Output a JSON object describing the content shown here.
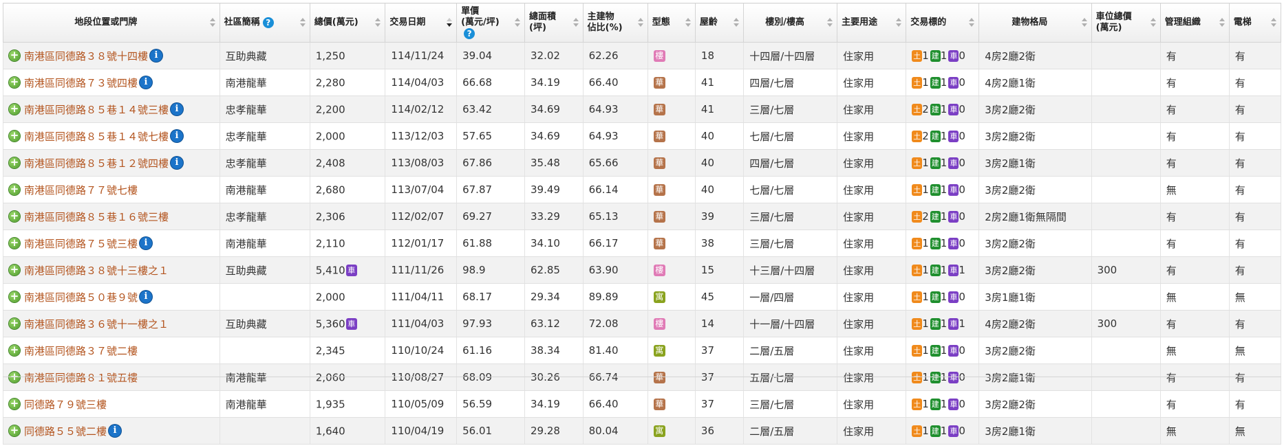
{
  "headers": [
    {
      "label": "地段位置或門牌",
      "center": true
    },
    {
      "label": "社區簡稱",
      "help": "?"
    },
    {
      "label": "總價(萬元)"
    },
    {
      "label": "交易日期",
      "active": true
    },
    {
      "label": "單價\n(萬元/坪)",
      "help": "?"
    },
    {
      "label": "總面積\n(坪)"
    },
    {
      "label": "主建物\n佔比(%)"
    },
    {
      "label": "型態"
    },
    {
      "label": "屋齡"
    },
    {
      "label": "樓別/樓高",
      "center": true
    },
    {
      "label": "主要用途"
    },
    {
      "label": "交易標的"
    },
    {
      "label": "建物格局",
      "center": true
    },
    {
      "label": "車位總價\n(萬元)"
    },
    {
      "label": "管理組織"
    },
    {
      "label": "電梯"
    }
  ],
  "labels": {
    "land": "土",
    "building": "建",
    "car": "車",
    "expand": "+",
    "info": "i"
  },
  "colors": {
    "land": "#f08a1c",
    "building": "#1f8f2e",
    "car": "#7b3fc4",
    "type_樓": "#e07bb6",
    "type_華": "#b5734a",
    "type_寓": "#8aa31f"
  },
  "rows": [
    {
      "address": "南港區同德路３８號十四樓",
      "info": true,
      "community": "互助典藏",
      "total": "1,250",
      "car_in_total": false,
      "date": "114/11/24",
      "unit": "39.04",
      "area": "32.02",
      "ratio": "62.26",
      "type": "樓",
      "age": "18",
      "floor": "十四層/十四層",
      "use": "住家用",
      "land_n": "1",
      "bldg_n": "1",
      "car_n": "0",
      "layout": "4房2廳2衛",
      "car_price": "",
      "mgmt": "有",
      "elevator": "有"
    },
    {
      "address": "南港區同德路７３號四樓",
      "info": true,
      "community": "南港龍華",
      "total": "2,280",
      "car_in_total": false,
      "date": "114/04/03",
      "unit": "66.68",
      "area": "34.19",
      "ratio": "66.40",
      "type": "華",
      "age": "41",
      "floor": "四層/七層",
      "use": "住家用",
      "land_n": "1",
      "bldg_n": "1",
      "car_n": "0",
      "layout": "4房2廳1衛",
      "car_price": "",
      "mgmt": "有",
      "elevator": "有"
    },
    {
      "address": "南港區同德路８５巷１４號三樓",
      "info": true,
      "community": "忠孝龍華",
      "total": "2,200",
      "car_in_total": false,
      "date": "114/02/12",
      "unit": "63.42",
      "area": "34.69",
      "ratio": "64.93",
      "type": "華",
      "age": "41",
      "floor": "三層/七層",
      "use": "住家用",
      "land_n": "2",
      "bldg_n": "1",
      "car_n": "0",
      "layout": "3房2廳2衛",
      "car_price": "",
      "mgmt": "有",
      "elevator": "有"
    },
    {
      "address": "南港區同德路８５巷１４號七樓",
      "info": true,
      "community": "忠孝龍華",
      "total": "2,000",
      "car_in_total": false,
      "date": "113/12/03",
      "unit": "57.65",
      "area": "34.69",
      "ratio": "64.93",
      "type": "華",
      "age": "40",
      "floor": "七層/七層",
      "use": "住家用",
      "land_n": "2",
      "bldg_n": "1",
      "car_n": "0",
      "layout": "3房2廳2衛",
      "car_price": "",
      "mgmt": "有",
      "elevator": "有"
    },
    {
      "address": "南港區同德路８５巷１２號四樓",
      "info": true,
      "community": "忠孝龍華",
      "total": "2,408",
      "car_in_total": false,
      "date": "113/08/03",
      "unit": "67.86",
      "area": "35.48",
      "ratio": "65.66",
      "type": "華",
      "age": "40",
      "floor": "四層/七層",
      "use": "住家用",
      "land_n": "1",
      "bldg_n": "1",
      "car_n": "0",
      "layout": "3房2廳1衛",
      "car_price": "",
      "mgmt": "有",
      "elevator": "有"
    },
    {
      "address": "南港區同德路７７號七樓",
      "info": false,
      "community": "南港龍華",
      "total": "2,680",
      "car_in_total": false,
      "date": "113/07/04",
      "unit": "67.87",
      "area": "39.49",
      "ratio": "66.14",
      "type": "華",
      "age": "40",
      "floor": "七層/七層",
      "use": "住家用",
      "land_n": "1",
      "bldg_n": "1",
      "car_n": "0",
      "layout": "3房2廳2衛",
      "car_price": "",
      "mgmt": "無",
      "elevator": "有"
    },
    {
      "address": "南港區同德路８５巷１６號三樓",
      "info": false,
      "community": "忠孝龍華",
      "total": "2,306",
      "car_in_total": false,
      "date": "112/02/07",
      "unit": "69.27",
      "area": "33.29",
      "ratio": "65.13",
      "type": "華",
      "age": "39",
      "floor": "三層/七層",
      "use": "住家用",
      "land_n": "2",
      "bldg_n": "1",
      "car_n": "0",
      "layout": "2房2廳1衛無隔間",
      "car_price": "",
      "mgmt": "有",
      "elevator": "有"
    },
    {
      "address": "南港區同德路７５號三樓",
      "info": true,
      "community": "南港龍華",
      "total": "2,110",
      "car_in_total": false,
      "date": "112/01/17",
      "unit": "61.88",
      "area": "34.10",
      "ratio": "66.17",
      "type": "華",
      "age": "38",
      "floor": "三層/七層",
      "use": "住家用",
      "land_n": "1",
      "bldg_n": "1",
      "car_n": "0",
      "layout": "3房2廳2衛",
      "car_price": "",
      "mgmt": "有",
      "elevator": "有"
    },
    {
      "address": "南港區同德路３８號十三樓之１",
      "info": false,
      "community": "互助典藏",
      "total": "5,410",
      "car_in_total": true,
      "date": "111/11/26",
      "unit": "98.9",
      "area": "62.85",
      "ratio": "63.90",
      "type": "樓",
      "age": "15",
      "floor": "十三層/十四層",
      "use": "住家用",
      "land_n": "1",
      "bldg_n": "1",
      "car_n": "1",
      "layout": "3房2廳2衛",
      "car_price": "300",
      "mgmt": "有",
      "elevator": "有"
    },
    {
      "address": "南港區同德路５０巷９號",
      "info": true,
      "community": "",
      "total": "2,000",
      "car_in_total": false,
      "date": "111/04/11",
      "unit": "68.17",
      "area": "29.34",
      "ratio": "89.89",
      "type": "寓",
      "age": "45",
      "floor": "一層/四層",
      "use": "住家用",
      "land_n": "1",
      "bldg_n": "1",
      "car_n": "0",
      "layout": "3房1廳1衛",
      "car_price": "",
      "mgmt": "無",
      "elevator": "無"
    },
    {
      "address": "南港區同德路３６號十一樓之１",
      "info": false,
      "community": "互助典藏",
      "total": "5,360",
      "car_in_total": true,
      "date": "111/04/03",
      "unit": "97.93",
      "area": "63.12",
      "ratio": "72.08",
      "type": "樓",
      "age": "14",
      "floor": "十一層/十四層",
      "use": "住家用",
      "land_n": "1",
      "bldg_n": "1",
      "car_n": "1",
      "layout": "4房2廳2衛",
      "car_price": "300",
      "mgmt": "有",
      "elevator": "有"
    },
    {
      "address": "南港區同德路３７號二樓",
      "info": false,
      "community": "",
      "total": "2,345",
      "car_in_total": false,
      "date": "110/10/24",
      "unit": "61.16",
      "area": "38.34",
      "ratio": "81.40",
      "type": "寓",
      "age": "37",
      "floor": "二層/五層",
      "use": "住家用",
      "land_n": "1",
      "bldg_n": "1",
      "car_n": "0",
      "layout": "3房2廳2衛",
      "car_price": "",
      "mgmt": "無",
      "elevator": "無"
    },
    {
      "address": "南港區同德路８１號五樓",
      "info": false,
      "community": "南港龍華",
      "total": "2,060",
      "car_in_total": false,
      "date": "110/08/27",
      "unit": "68.09",
      "area": "30.26",
      "ratio": "66.74",
      "type": "華",
      "age": "37",
      "floor": "五層/七層",
      "use": "住家用",
      "land_n": "1",
      "bldg_n": "1",
      "car_n": "0",
      "layout": "3房2廳1衛",
      "car_price": "",
      "mgmt": "有",
      "elevator": "有"
    },
    {
      "address": "同德路７９號三樓",
      "info": false,
      "community": "南港龍華",
      "total": "1,935",
      "car_in_total": false,
      "date": "110/05/09",
      "unit": "56.59",
      "area": "34.19",
      "ratio": "66.40",
      "type": "華",
      "age": "37",
      "floor": "三層/七層",
      "use": "住家用",
      "land_n": "1",
      "bldg_n": "1",
      "car_n": "0",
      "layout": "3房2廳2衛",
      "car_price": "",
      "mgmt": "有",
      "elevator": "有"
    },
    {
      "address": "同德路５５號二樓",
      "info": true,
      "community": "",
      "total": "1,640",
      "car_in_total": false,
      "date": "110/04/19",
      "unit": "56.01",
      "area": "29.28",
      "ratio": "80.04",
      "type": "寓",
      "age": "36",
      "floor": "二層/五層",
      "use": "住家用",
      "land_n": "1",
      "bldg_n": "1",
      "car_n": "0",
      "layout": "3房2廳1衛",
      "car_price": "",
      "mgmt": "無",
      "elevator": "無"
    }
  ]
}
